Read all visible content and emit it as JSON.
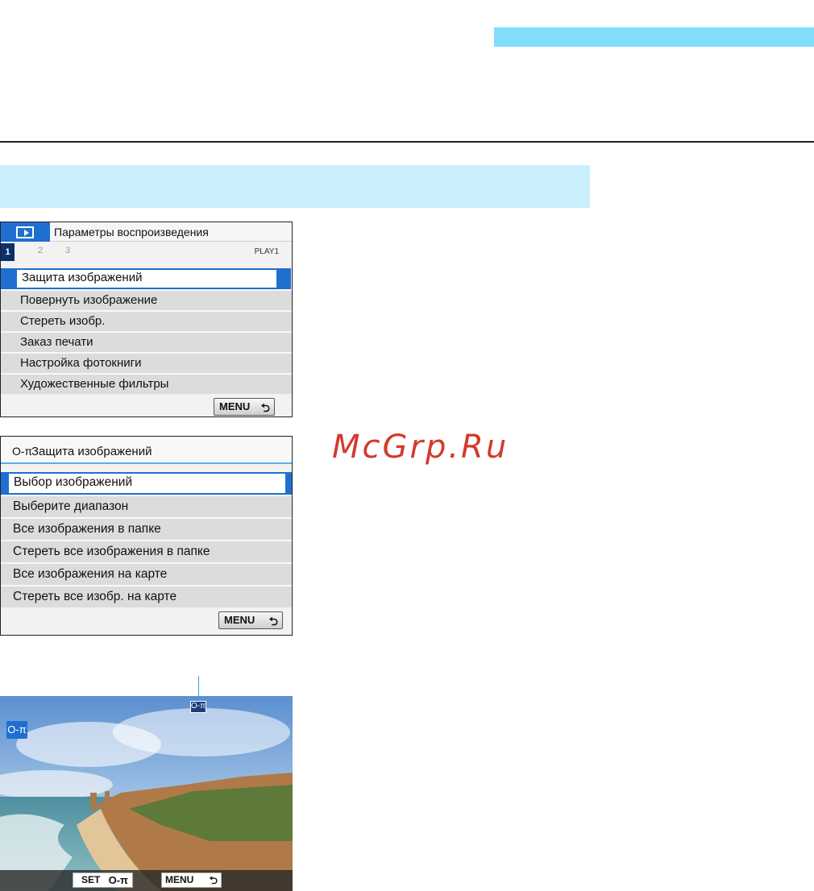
{
  "screen1": {
    "title": "Параметры воспроизведения",
    "pages": [
      "1",
      "2",
      "3"
    ],
    "page_label": "PLAY1",
    "items": [
      "Защита изображений",
      "Повернуть изображение",
      "Стереть изобр.",
      "Заказ печати",
      "Настройка фотокниги",
      "Художественные фильтры"
    ],
    "menu_button": "MENU",
    "back_icon": "⮌"
  },
  "screen2": {
    "key_icon": "o-π",
    "title": "Защита изображений",
    "items": [
      "Выбор изображений",
      "Выберите диапазон",
      "Все изображения в папке",
      "Стереть все изображения в папке",
      "Все изображения на карте",
      "Стереть все изобр. на карте"
    ],
    "menu_button": "MENU"
  },
  "watermark": "McGrp.Ru",
  "screen3": {
    "set_button": "SET",
    "menu_button": "MENU",
    "key_icon_glyph": "O-π"
  },
  "colors": {
    "accent_blue": "#1f6fd0",
    "top_bar": "#82dcfb",
    "section_band": "#c9eefc",
    "watermark": "#d33a2c"
  }
}
